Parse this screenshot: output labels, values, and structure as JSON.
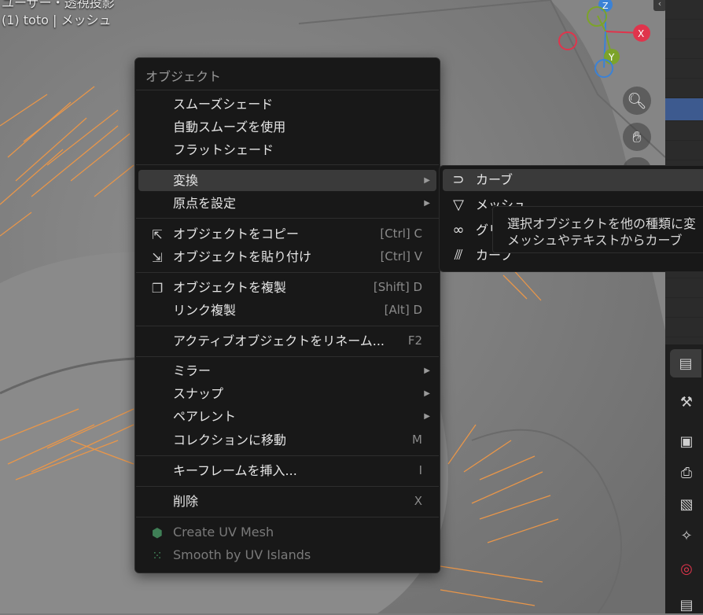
{
  "viewport": {
    "mode_label": "ユーザー・透視投影",
    "object_label": "(1) toto | メッシュ"
  },
  "gizmo": {
    "z": "Z",
    "y": "Y",
    "x": "X"
  },
  "nav_icons": [
    "zoom-icon",
    "hand-pan-icon",
    "camera-icon"
  ],
  "menu": {
    "title": "オブジェクト",
    "items": [
      {
        "label": "スムーズシェード"
      },
      {
        "label": "自動スムーズを使用"
      },
      {
        "label": "フラットシェード"
      },
      {
        "label": "変換",
        "submenu": true
      },
      {
        "label": "原点を設定",
        "submenu": true
      },
      {
        "label": "オブジェクトをコピー",
        "shortcut": "[Ctrl] C",
        "icon": "copy-object-icon"
      },
      {
        "label": "オブジェクトを貼り付け",
        "shortcut": "[Ctrl] V",
        "icon": "paste-object-icon"
      },
      {
        "label": "オブジェクトを複製",
        "shortcut": "[Shift] D",
        "icon": "duplicate-icon"
      },
      {
        "label": "リンク複製",
        "shortcut": "[Alt] D"
      },
      {
        "label": "アクティブオブジェクトをリネーム...",
        "shortcut": "F2"
      },
      {
        "label": "ミラー",
        "submenu": true
      },
      {
        "label": "スナップ",
        "submenu": true
      },
      {
        "label": "ペアレント",
        "submenu": true
      },
      {
        "label": "コレクションに移動",
        "shortcut": "M"
      },
      {
        "label": "キーフレームを挿入...",
        "shortcut": "I"
      },
      {
        "label": "削除",
        "shortcut": "X"
      },
      {
        "label": "Create UV Mesh",
        "icon": "uv-mesh-addon-icon"
      },
      {
        "label": "Smooth by UV Islands",
        "icon": "uv-islands-addon-icon"
      }
    ]
  },
  "submenu": {
    "items": [
      {
        "label": "カーブ",
        "icon": "curve-icon"
      },
      {
        "label": "メッシュ",
        "icon": "mesh-icon"
      },
      {
        "label": "グリース",
        "icon": "grease-pencil-icon"
      },
      {
        "label": "カーブ",
        "icon": "curves-hair-icon"
      }
    ]
  },
  "tooltip": {
    "line1": "選択オブジェクトを他の種類に変",
    "line2": "メッシュやテキストからカーブ"
  },
  "colors": {
    "menu_bg": "#181818",
    "highlight": "#3a3a3a",
    "hair": "#e8964a",
    "axis_x": "#e0344c",
    "axis_y": "#7ca32a",
    "axis_z": "#3b82d6",
    "selection": "#3d5a8f"
  }
}
